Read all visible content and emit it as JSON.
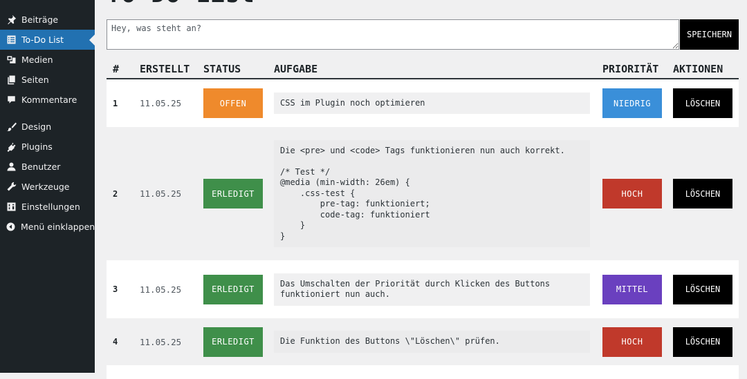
{
  "sidebar": {
    "items": [
      {
        "label": "Beiträge",
        "icon": "pin-icon"
      },
      {
        "label": "To-Do List",
        "icon": "list-icon"
      },
      {
        "label": "Medien",
        "icon": "media-icon"
      },
      {
        "label": "Seiten",
        "icon": "pages-icon"
      },
      {
        "label": "Kommentare",
        "icon": "comment-icon"
      },
      {
        "label": "Design",
        "icon": "brush-icon"
      },
      {
        "label": "Plugins",
        "icon": "plug-icon"
      },
      {
        "label": "Benutzer",
        "icon": "user-icon"
      },
      {
        "label": "Werkzeuge",
        "icon": "wrench-icon"
      },
      {
        "label": "Einstellungen",
        "icon": "sliders-icon"
      },
      {
        "label": "Menü einklappen",
        "icon": "collapse-icon"
      }
    ],
    "active_index": 1
  },
  "page": {
    "title": "To-Do List"
  },
  "new_task": {
    "placeholder": "Hey, was steht an?",
    "value": "",
    "save_label": "SPEICHERN"
  },
  "table": {
    "headers": {
      "num": "#",
      "created": "ERSTELLT",
      "status": "STATUS",
      "task": "AUFGABE",
      "priority": "PRIORITÄT",
      "actions": "AKTIONEN"
    },
    "rows": [
      {
        "num": "1",
        "created": "11.05.25",
        "status": "OFFEN",
        "task": "CSS im Plugin noch optimieren",
        "priority": "NIEDRIG",
        "action": "LÖSCHEN"
      },
      {
        "num": "2",
        "created": "11.05.25",
        "status": "ERLEDIGT",
        "task": "Die <pre> und <code> Tags funktionieren nun auch korrekt.\n\n/* Test */\n@media (min-width: 26em) {\n    .css-test {\n        pre-tag: funktioniert;\n        code-tag: funktioniert\n    }\n}",
        "priority": "HOCH",
        "action": "LÖSCHEN"
      },
      {
        "num": "3",
        "created": "11.05.25",
        "status": "ERLEDIGT",
        "task": "Das Umschalten der Priorität durch Klicken des Buttons\nfunktioniert nun auch.",
        "priority": "MITTEL",
        "action": "LÖSCHEN"
      },
      {
        "num": "4",
        "created": "11.05.25",
        "status": "ERLEDIGT",
        "task": "Die Funktion des Buttons \\\"Löschen\\\" prüfen.",
        "priority": "HOCH",
        "action": "LÖSCHEN"
      }
    ]
  },
  "colors": {
    "status_open": "#ef8a2c",
    "status_done": "#3f8f4a",
    "priority_low": "#3a8fd9",
    "priority_high": "#c0392b",
    "priority_medium": "#6a40bf",
    "sidebar_bg": "#1d2327",
    "sidebar_active": "#2271b1"
  }
}
